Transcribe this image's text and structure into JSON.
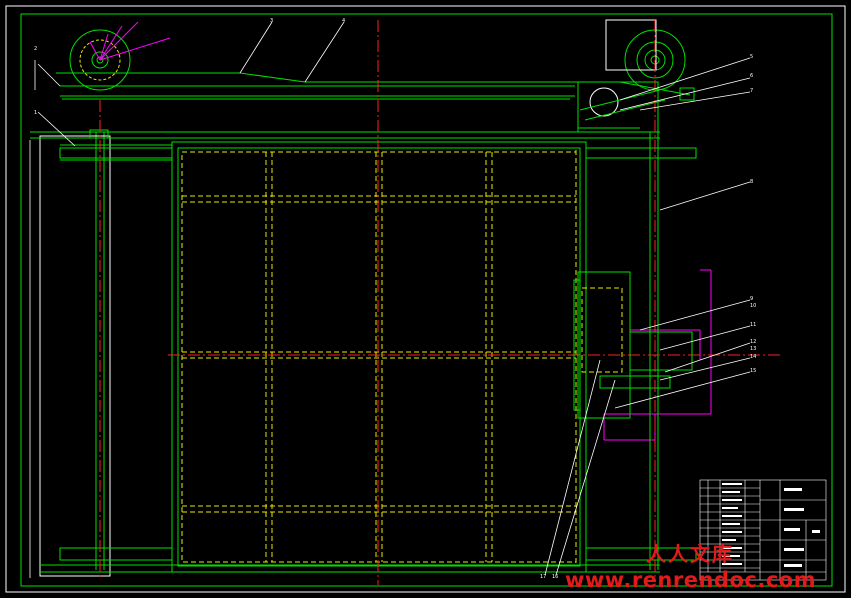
{
  "drawing": {
    "title": "",
    "colors": {
      "frame": "#ffffff",
      "outline": "#00e000",
      "hidden": "#e8e800",
      "center": "#ff2020",
      "dimension": "#ffffff",
      "accent": "#ff00ff"
    },
    "balloons": [
      "1",
      "2",
      "3",
      "4",
      "5",
      "6",
      "7",
      "8",
      "9",
      "10",
      "11",
      "12",
      "13",
      "14",
      "15",
      "16",
      "17"
    ],
    "title_block": {
      "rows": 12
    }
  },
  "watermark": {
    "logo": "人人文库",
    "url": "www.renrendoc.com"
  }
}
